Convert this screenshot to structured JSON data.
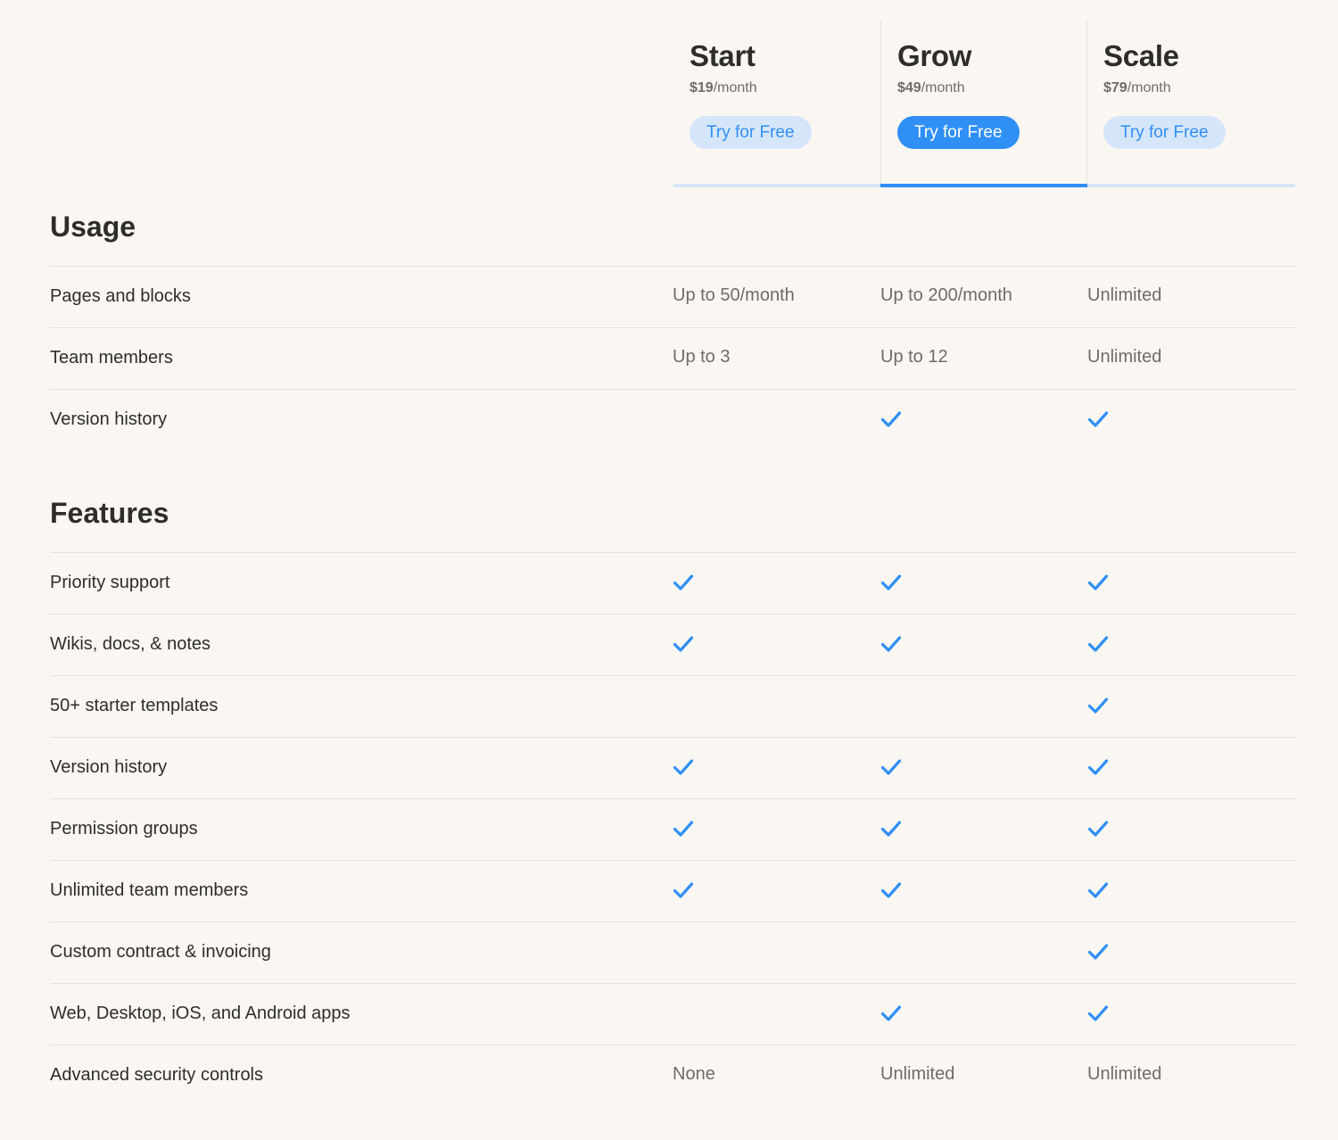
{
  "plans": [
    {
      "name": "Start",
      "price": "$19",
      "period": "/month",
      "cta": "Try for Free",
      "highlighted": false
    },
    {
      "name": "Grow",
      "price": "$49",
      "period": "/month",
      "cta": "Try for Free",
      "highlighted": true
    },
    {
      "name": "Scale",
      "price": "$79",
      "period": "/month",
      "cta": "Try for Free",
      "highlighted": false
    }
  ],
  "colors": {
    "accent": "#2f8ff5",
    "accent_light": "#d6e6fa",
    "background": "#faf7f2",
    "text": "#2f2d2a",
    "muted": "#6f6c68",
    "divider": "#e3e1dd"
  },
  "sections": [
    {
      "title": "Usage",
      "rows": [
        {
          "label": "Pages and blocks",
          "values": [
            "Up to 50/month",
            "Up to 200/month",
            "Unlimited"
          ]
        },
        {
          "label": "Team members",
          "values": [
            "Up to 3",
            "Up to 12",
            "Unlimited"
          ]
        },
        {
          "label": "Version history",
          "values": [
            "",
            "check-icon",
            "check-icon"
          ]
        }
      ]
    },
    {
      "title": "Features",
      "rows": [
        {
          "label": "Priority support",
          "values": [
            "check-icon",
            "check-icon",
            "check-icon"
          ]
        },
        {
          "label": "Wikis, docs, & notes",
          "values": [
            "check-icon",
            "check-icon",
            "check-icon"
          ]
        },
        {
          "label": "50+ starter templates",
          "values": [
            "",
            "",
            "check-icon"
          ]
        },
        {
          "label": "Version history",
          "values": [
            "check-icon",
            "check-icon",
            "check-icon"
          ]
        },
        {
          "label": "Permission groups",
          "values": [
            "check-icon",
            "check-icon",
            "check-icon"
          ]
        },
        {
          "label": "Unlimited team members",
          "values": [
            "check-icon",
            "check-icon",
            "check-icon"
          ]
        },
        {
          "label": "Custom contract & invoicing",
          "values": [
            "",
            "",
            "check-icon"
          ]
        },
        {
          "label": "Web, Desktop, iOS, and Android apps",
          "values": [
            "",
            "check-icon",
            "check-icon"
          ]
        },
        {
          "label": "Advanced security controls",
          "values": [
            "None",
            "Unlimited",
            "Unlimited"
          ]
        }
      ]
    }
  ]
}
